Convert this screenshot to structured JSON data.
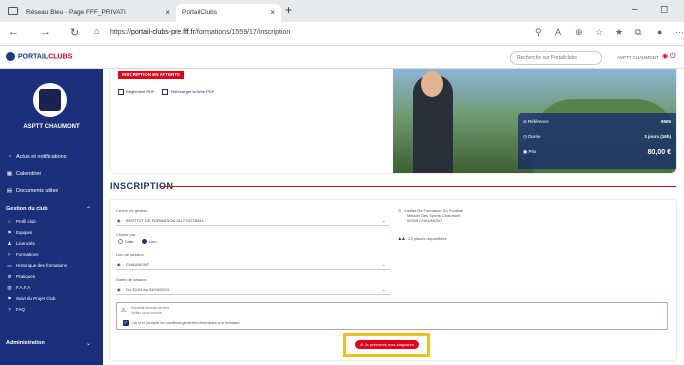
{
  "browser": {
    "tabs": [
      {
        "label": "Réseau Bleu - Page FFF_PRIVATI"
      },
      {
        "label": "PortailClubs"
      }
    ],
    "tab_close": "×",
    "new_tab": "+",
    "url_prefix": "https://",
    "url_host": "portail-clubs-pre.fff.fr",
    "url_path": "/formations/1559/17/inscription",
    "minimize": "–",
    "restore": "◻"
  },
  "app": {
    "logo_main": "PORTAIL",
    "logo_accent": "CLUBS",
    "search_placeholder": "Recherche sur Portailclubs",
    "user_label": "ASPTT CHAUMONT"
  },
  "sidebar": {
    "club_name": "ASPTT CHAUMONT",
    "items": [
      {
        "label": "Actus et notifications",
        "icon": "bell-icon"
      },
      {
        "label": "Calendrier",
        "icon": "calendar-icon"
      },
      {
        "label": "Documents utiles",
        "icon": "document-icon"
      }
    ],
    "group_title": "Gestion du club",
    "group_items": [
      {
        "label": "Profil club"
      },
      {
        "label": "Equipes"
      },
      {
        "label": "Licenciés"
      },
      {
        "label": "Formations"
      },
      {
        "label": "Historique des formations"
      },
      {
        "label": "Pratiques"
      },
      {
        "label": "F.A.F.A"
      },
      {
        "label": "Suivi du Projet Club"
      },
      {
        "label": "FAQ"
      }
    ],
    "admin_title": "Administration"
  },
  "training": {
    "status_badge": "INSCRIPTION EN ATTENTE",
    "links": [
      {
        "label": "Règlement PDF"
      },
      {
        "label": "Télécharger la fiche PDF"
      }
    ],
    "reference_label": "Référence",
    "reference_value": "6505",
    "duration_label": "Durée",
    "duration_value": "3 jours (16h)",
    "price_label": "Prix",
    "price_value": "80,00 €"
  },
  "form": {
    "section_title": "INSCRIPTION",
    "center_label": "Centre de gestion",
    "center_value": "INSTITUT DE FORMATION DU FOOTBALL",
    "choice_label": "Choisir par",
    "choice_date": "Date",
    "choice_place": "Lieu",
    "place_label": "Lieu de session",
    "place_value": "CHAUMONT",
    "dates_label": "Dates de session",
    "dates_value": "Du 22/04 au 24/04/2024",
    "institute_name": "Institut De Formation Du Football",
    "institute_addr1": "Maison Des Sports Chaumont",
    "institute_addr2": "52000 CHAUMONT",
    "seats": "23 places disponibles",
    "warning_line1": "Nouvelle session de test",
    "warning_line2": "Veillez vous inscrire",
    "checkbox_label": "J'ai lu et j'accepte les conditions générales d'inscription à la formation",
    "submit_label": "Je préinscris mes stagiaires"
  }
}
